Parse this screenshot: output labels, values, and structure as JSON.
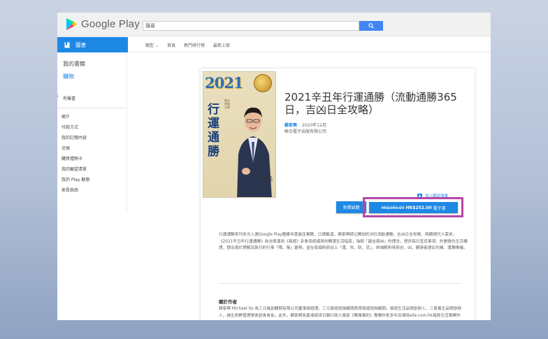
{
  "header": {
    "brand": "Google Play",
    "search_value": "搜尋"
  },
  "category": {
    "label": "圖書",
    "nav": [
      "類型",
      "首頁",
      "熱門排行榜",
      "最新上架"
    ]
  },
  "sidebar": {
    "my_books": "我的書籍",
    "shop": "購物",
    "my_books_2": "有聲書",
    "links": [
      "帳戶",
      "付款方式",
      "我的訂閱內容",
      "兌換",
      "購買禮物卡",
      "我的願望清單",
      "我的 Play 動態",
      "家長指南"
    ]
  },
  "cover": {
    "year": "2021",
    "title": "行運通勝",
    "side_text": "風水命理大師",
    "signature": "蘇民峰"
  },
  "book": {
    "title": "2021辛丑年行運通勝（流動通勝365日，吉凶日全攻略）",
    "author": "蘇家興",
    "date": "2020年12月",
    "publisher": "聯合電子出版有限公司",
    "wishlist": "加入願望清單",
    "sample_button": "免費試閱",
    "price_old": "HK$360.00",
    "price_new": "HK$252.00",
    "price_suffix": "電子書"
  },
  "description": {
    "p1": "行運通勝系列多次入選Google Play圖書年度最佳書籍，口碑載道。蘇家興師父開創的365流動通勝，吉凶日全攻略，與顧現代人需求。",
    "p2": "《2021辛丑年行運通勝》為全面運用《易經》卦象系統編寫的開運生活指南，強調「趨吉避凶」的理念，提供每日宜忌事項、計劃微化生活構想，提出易於理解及執行的行事「陽、陰」變勢，並在每個時辰註上「運、攻、防、忌」，詳細解析時辰吉、凶、擴張者適佔先機、運籌帷幄。"
  },
  "about": {
    "heading": "關於作者",
    "text": "蘇家興 Michael So 為三元風創顧問有限公司董事總經理，三元易經諮詢顧問首席易經諮詢顧問。易經生活品牌創辦人，三易養生品牌創辦人，緣生術數管理學會創會會長。此外，蘇家興為香港經濟日報行政人員版《職場事的》專欄作家多年及現時elle.com.hk易經生活專欄作家。"
  }
}
